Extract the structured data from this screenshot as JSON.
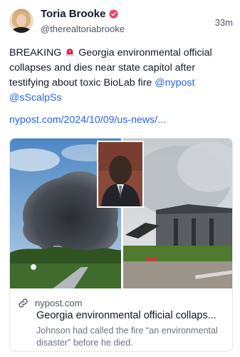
{
  "post": {
    "author": {
      "display_name": "Toria Brooke",
      "handle": "@therealtoriabrooke",
      "verified_icon": "verified-check-icon"
    },
    "timestamp": "33m",
    "text_before": "BREAKING",
    "emoji": "siren-icon",
    "text_main": " Georgia environmental official collapses and dies near state capitol after testifying about toxic BioLab fire ",
    "mentions": [
      "@nypost",
      "@sScalpSs"
    ],
    "link": "nypost.com/2024/10/09/us-news/..."
  },
  "link_card": {
    "domain": "nypost.com",
    "title": "Georgia environmental official collaps...",
    "description": "Johnson had called the fire “an environmental disaster” before he died.",
    "icon": "link-icon"
  },
  "colors": {
    "link": "#2563eb",
    "verified": "#e9456d",
    "text": "#111827",
    "muted": "#4b5563"
  }
}
